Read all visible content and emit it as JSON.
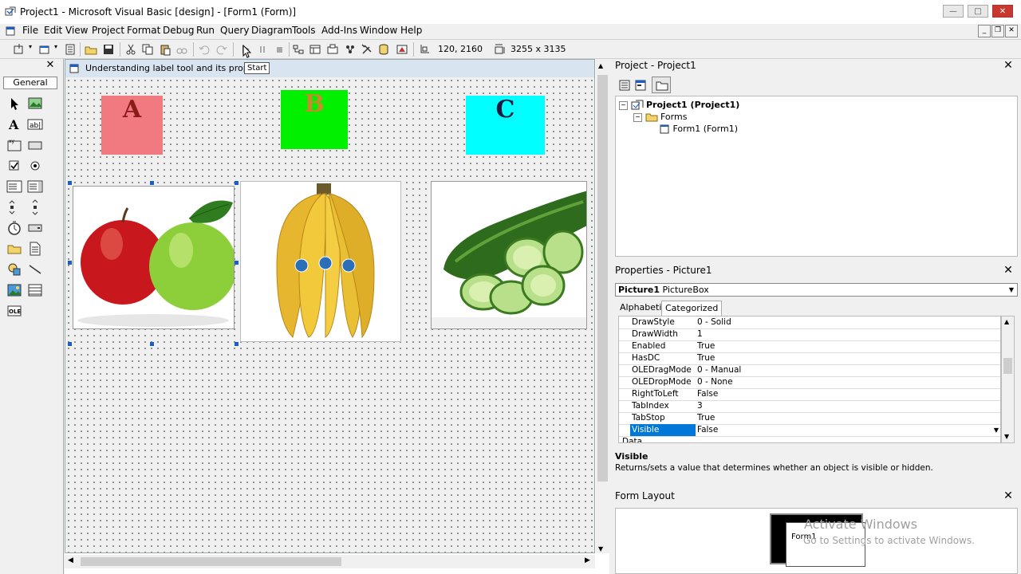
{
  "window": {
    "title": "Project1 - Microsoft Visual Basic [design] - [Form1 (Form)]",
    "controls": [
      "minimize",
      "maximize",
      "close"
    ]
  },
  "menu": {
    "items": [
      "File",
      "Edit",
      "View",
      "Project",
      "Format",
      "Debug",
      "Run",
      "Query",
      "Diagram",
      "Tools",
      "Add-Ins",
      "Window",
      "Help"
    ]
  },
  "toolbar": {
    "position": "120, 2160",
    "size": "3255 x 3135",
    "tooltip": "Start"
  },
  "toolbox": {
    "tab": "General"
  },
  "form": {
    "caption": "Understanding label tool and its properti",
    "labels": [
      {
        "text": "A",
        "bg": "#f07a80",
        "color": "#8b1a1a"
      },
      {
        "text": "B",
        "bg": "#00f000",
        "color": "#c88a2a"
      },
      {
        "text": "C",
        "bg": "#00ffff",
        "color": "#1a1a40"
      }
    ],
    "pictures": [
      "apples",
      "bananas",
      "cucumber"
    ]
  },
  "project": {
    "title": "Project - Project1",
    "tree": {
      "root": "Project1 (Project1)",
      "folder": "Forms",
      "item": "Form1 (Form1)"
    }
  },
  "properties": {
    "title": "Properties - Picture1",
    "object_name": "Picture1",
    "object_type": "PictureBox",
    "tabs": [
      "Alphabetic",
      "Categorized"
    ],
    "rows": [
      {
        "name": "DrawStyle",
        "value": "0 - Solid"
      },
      {
        "name": "DrawWidth",
        "value": "1"
      },
      {
        "name": "Enabled",
        "value": "True"
      },
      {
        "name": "HasDC",
        "value": "True"
      },
      {
        "name": "OLEDragMode",
        "value": "0 - Manual"
      },
      {
        "name": "OLEDropMode",
        "value": "0 - None"
      },
      {
        "name": "RightToLeft",
        "value": "False"
      },
      {
        "name": "TabIndex",
        "value": "3"
      },
      {
        "name": "TabStop",
        "value": "True"
      },
      {
        "name": "Visible",
        "value": "False"
      }
    ],
    "partial_row": "Data",
    "description_title": "Visible",
    "description_text": "Returns/sets a value that determines whether an object is visible or hidden."
  },
  "form_layout": {
    "title": "Form Layout",
    "form_label": "Form1",
    "watermark_1": "Activate Windows",
    "watermark_2": "Go to Settings to activate Windows."
  },
  "colors": {
    "selection": "#0078d7",
    "handle": "#1a5fc8"
  }
}
